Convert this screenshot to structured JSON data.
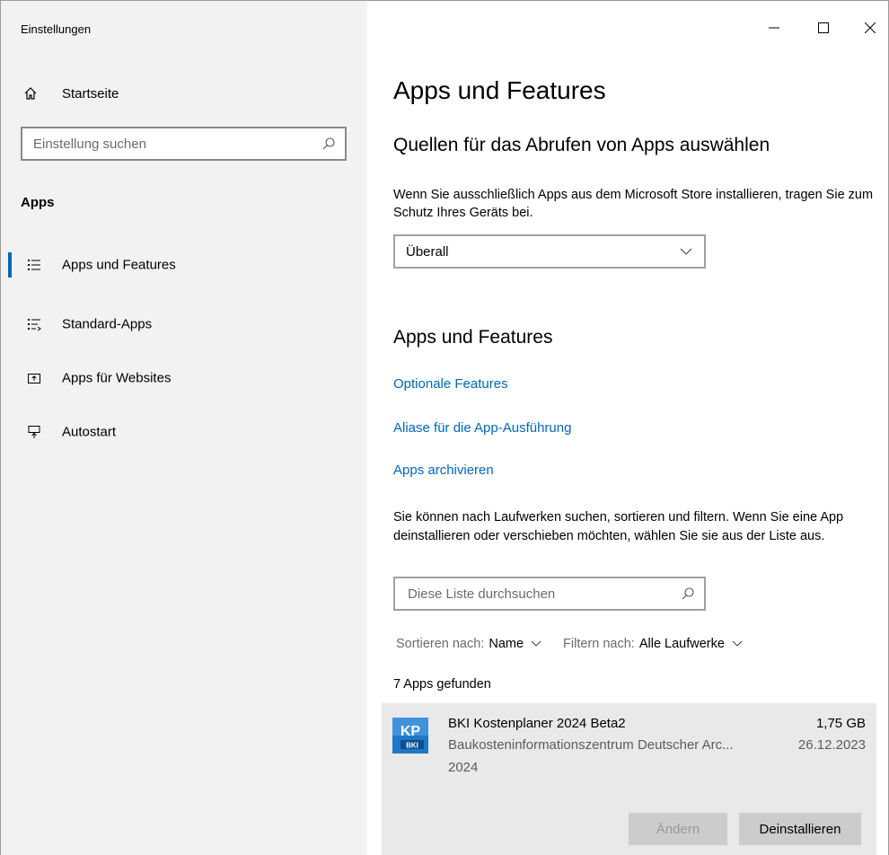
{
  "window": {
    "title": "Einstellungen"
  },
  "sidebar": {
    "home_label": "Startseite",
    "search_placeholder": "Einstellung suchen",
    "section_title": "Apps",
    "items": [
      {
        "label": "Apps und Features",
        "icon": "apps-list-icon",
        "active": true
      },
      {
        "label": "Standard-Apps",
        "icon": "default-apps-icon",
        "active": false
      },
      {
        "label": "Apps für Websites",
        "icon": "apps-websites-icon",
        "active": false
      },
      {
        "label": "Autostart",
        "icon": "startup-icon",
        "active": false
      }
    ]
  },
  "main": {
    "page_title": "Apps und Features",
    "sources": {
      "heading": "Quellen für das Abrufen von Apps auswählen",
      "description": "Wenn Sie ausschließlich Apps aus dem Microsoft Store installieren, tragen Sie zum Schutz Ihres Geräts bei.",
      "selected": "Überall"
    },
    "apps_section": {
      "heading": "Apps und Features",
      "links": [
        "Optionale Features",
        "Aliase für die App-Ausführung",
        "Apps archivieren"
      ],
      "description": "Sie können nach Laufwerken suchen, sortieren und filtern. Wenn Sie eine App deinstallieren oder verschieben möchten, wählen Sie sie aus der Liste aus.",
      "search_placeholder": "Diese Liste durchsuchen",
      "sort_label": "Sortieren nach:",
      "sort_value": "Name",
      "filter_label": "Filtern nach:",
      "filter_value": "Alle Laufwerke",
      "count_text": "7 Apps gefunden"
    },
    "app": {
      "name": "BKI Kostenplaner 2024 Beta2",
      "size": "1,75 GB",
      "publisher": "Baukosteninformationszentrum Deutscher Arc...",
      "date": "26.12.2023",
      "version": "2024",
      "icon_text_top": "KP",
      "icon_text_bottom": "BKI",
      "modify_label": "Ändern",
      "uninstall_label": "Deinstallieren"
    }
  },
  "colors": {
    "accent": "#0067c0",
    "sidebar_bg": "#f2f2f2",
    "card_bg": "#e9e9e9",
    "app_icon_blue": "#1d78c8"
  }
}
